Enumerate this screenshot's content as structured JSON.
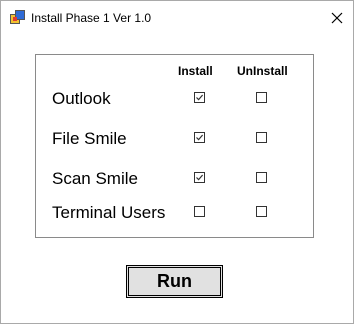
{
  "window": {
    "title": "Install Phase 1 Ver 1.0",
    "close_glyph": "✕"
  },
  "table": {
    "headers": {
      "install": "Install",
      "uninstall": "UnInstall"
    },
    "rows": [
      {
        "label": "Outlook",
        "install": true,
        "uninstall": false
      },
      {
        "label": "File Smile",
        "install": true,
        "uninstall": false
      },
      {
        "label": "Scan Smile",
        "install": true,
        "uninstall": false
      },
      {
        "label": "Terminal Users",
        "install": false,
        "uninstall": false
      }
    ]
  },
  "run_button": {
    "label": "Run"
  },
  "colors": {
    "app_icon_red": "#e03c31",
    "app_icon_blue": "#2f6bd6",
    "app_icon_yellow": "#f2c230"
  }
}
